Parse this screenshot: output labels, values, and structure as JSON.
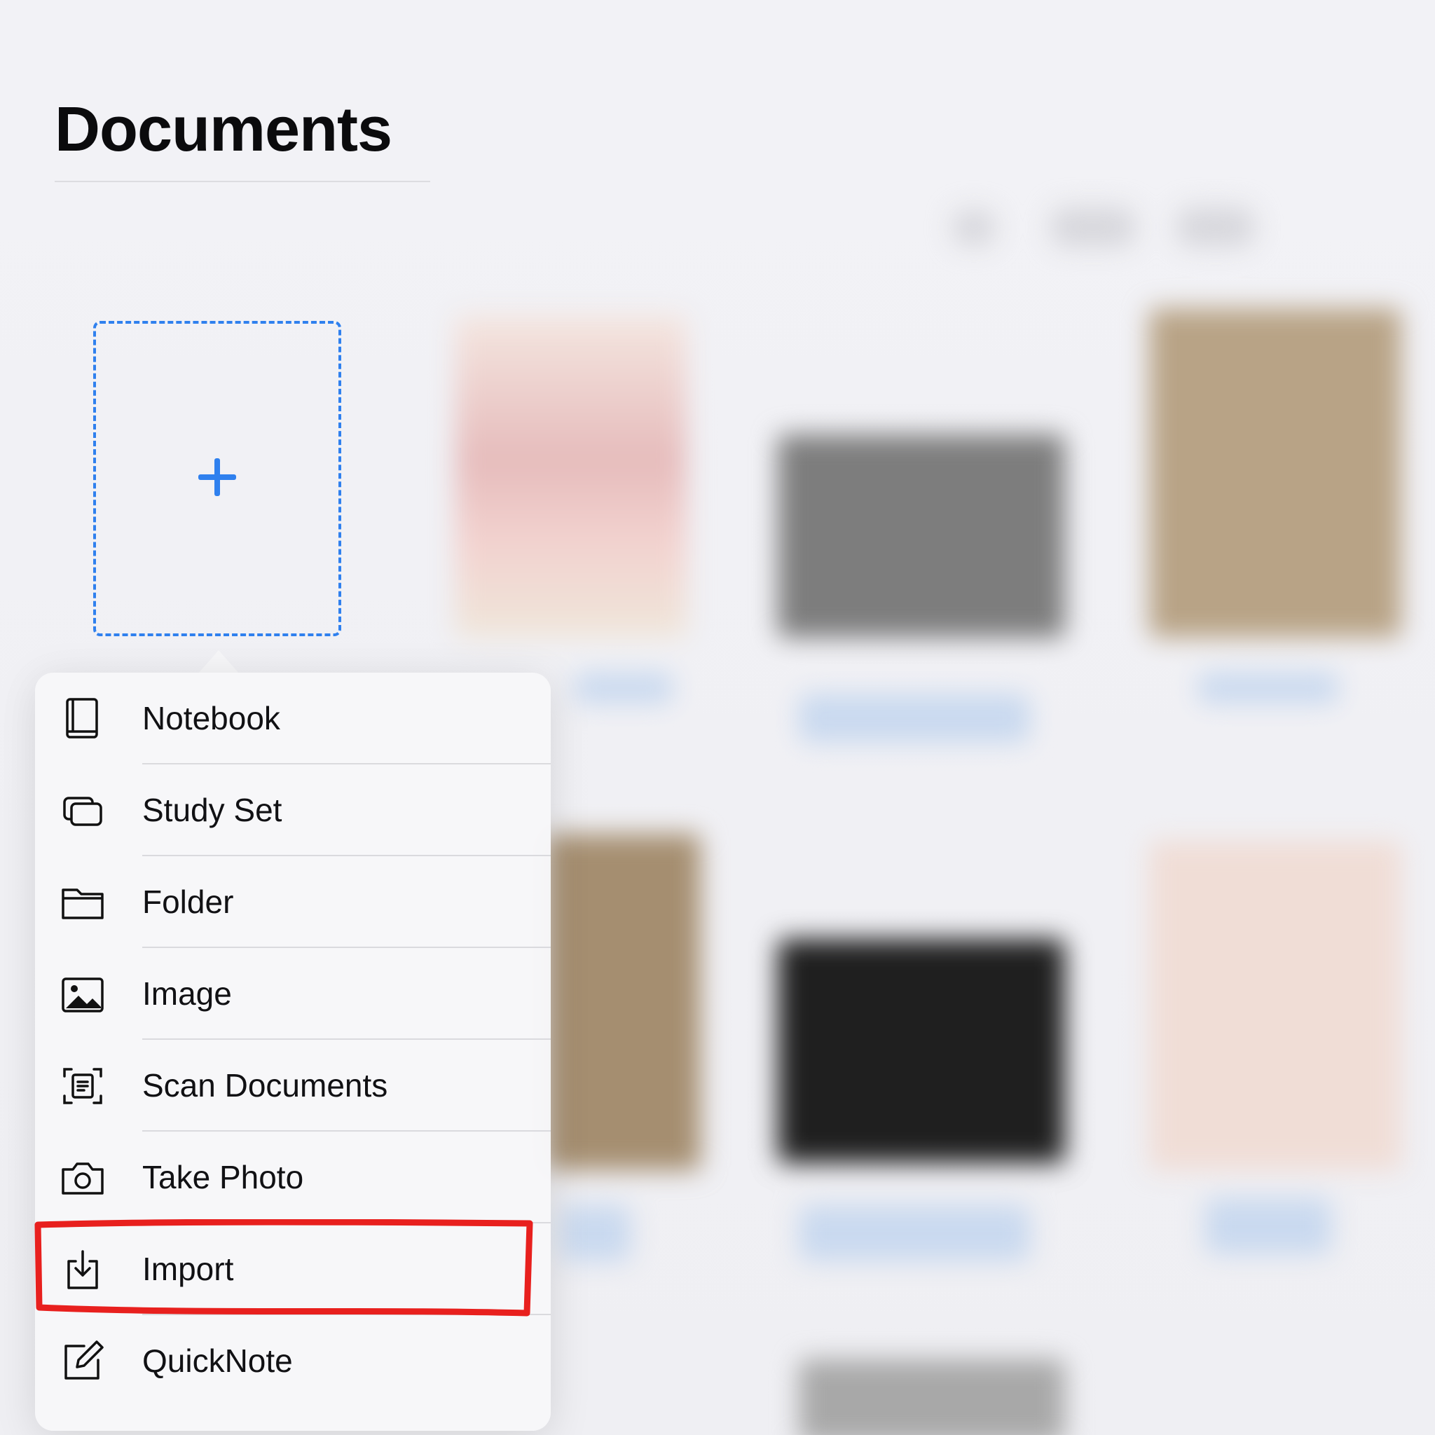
{
  "header": {
    "title": "Documents"
  },
  "add_tile": {
    "icon": "plus-icon",
    "accent_color": "#2f80ee"
  },
  "new_menu": {
    "items": [
      {
        "label": "Notebook",
        "icon": "notebook-icon"
      },
      {
        "label": "Study Set",
        "icon": "study-set-icon"
      },
      {
        "label": "Folder",
        "icon": "folder-icon"
      },
      {
        "label": "Image",
        "icon": "image-icon"
      },
      {
        "label": "Scan Documents",
        "icon": "scan-documents-icon"
      },
      {
        "label": "Take Photo",
        "icon": "camera-icon"
      },
      {
        "label": "Import",
        "icon": "import-icon"
      },
      {
        "label": "QuickNote",
        "icon": "quicknote-icon"
      }
    ],
    "highlighted_item": "Import",
    "highlight_color": "#e8201e"
  }
}
